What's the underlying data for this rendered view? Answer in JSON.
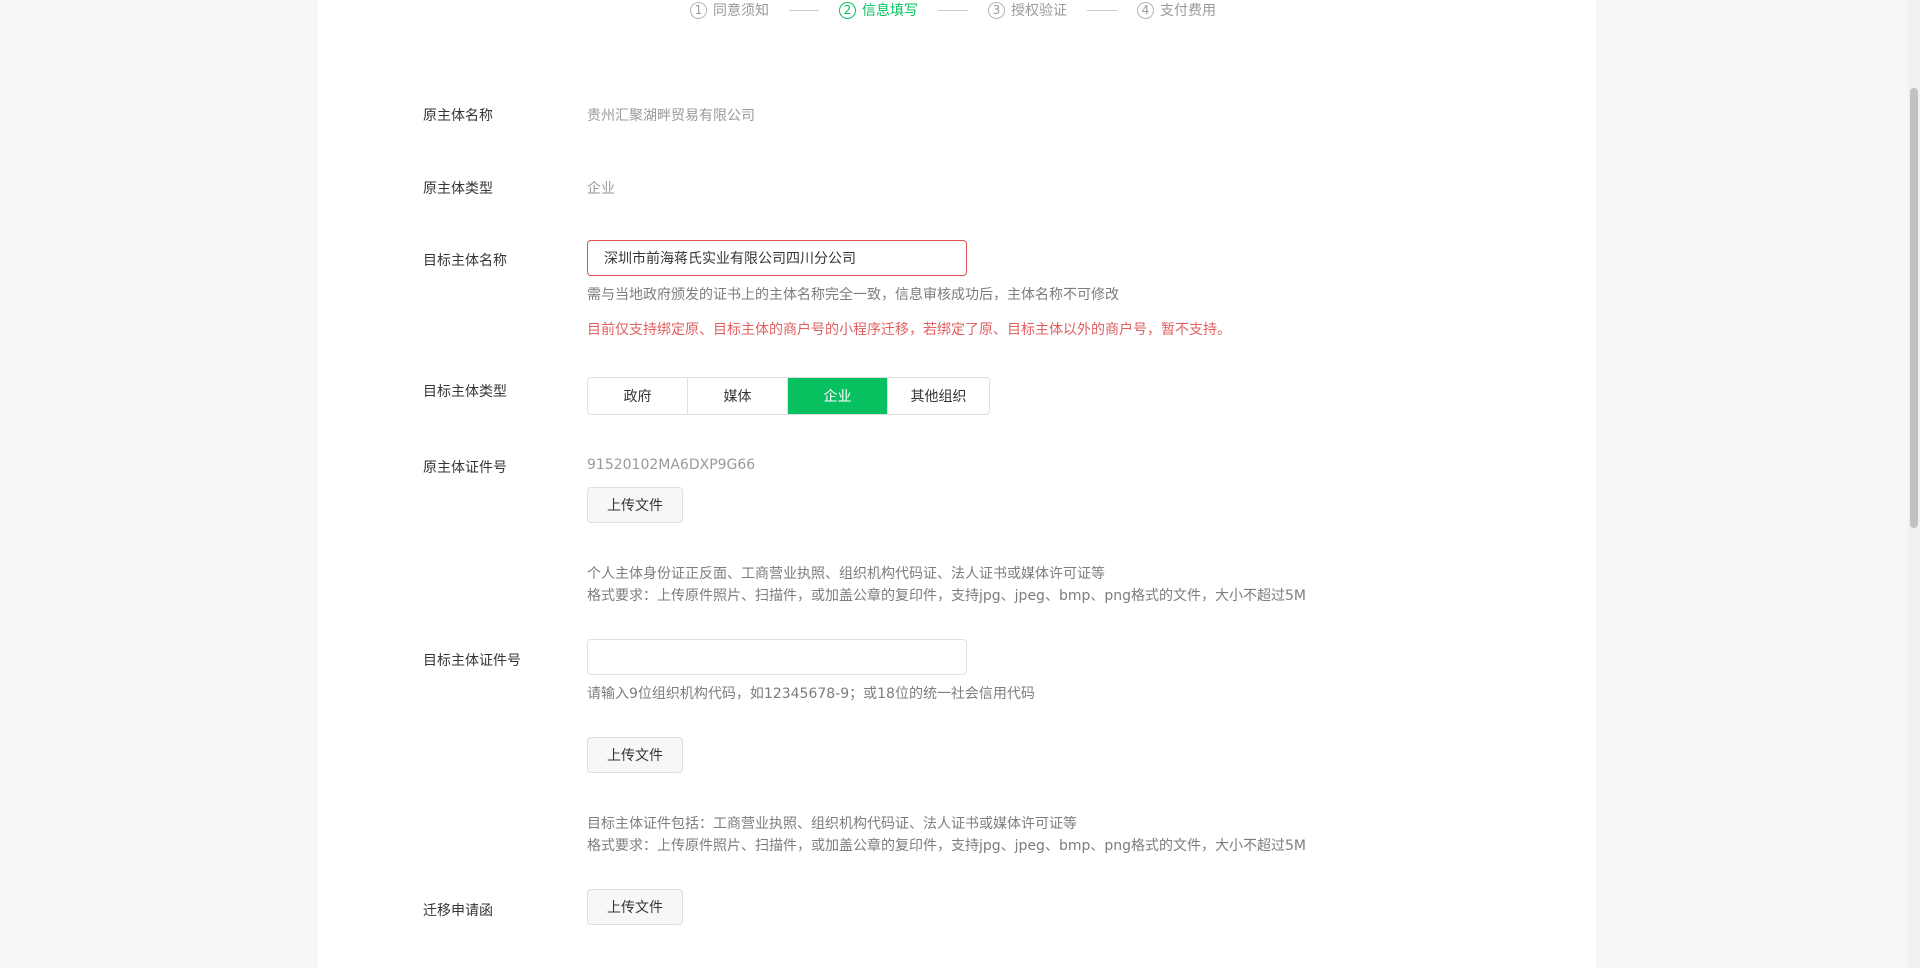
{
  "steps": [
    {
      "num": "1",
      "label": "同意须知"
    },
    {
      "num": "2",
      "label": "信息填写"
    },
    {
      "num": "3",
      "label": "授权验证"
    },
    {
      "num": "4",
      "label": "支付费用"
    }
  ],
  "form": {
    "orig_name_label": "原主体名称",
    "orig_name_value": "贵州汇聚湖畔贸易有限公司",
    "orig_type_label": "原主体类型",
    "orig_type_value": "企业",
    "target_name_label": "目标主体名称",
    "target_name_value": "深圳市前海蒋氏实业有限公司四川分公司",
    "target_name_tip": "需与当地政府颁发的证书上的主体名称完全一致，信息审核成功后，主体名称不可修改",
    "target_name_warning": "目前仅支持绑定原、目标主体的商户号的小程序迁移，若绑定了原、目标主体以外的商户号，暂不支持。",
    "target_type_label": "目标主体类型",
    "target_type_options": [
      "政府",
      "媒体",
      "企业",
      "其他组织"
    ],
    "target_type_selected": "企业",
    "orig_cert_label": "原主体证件号",
    "orig_cert_value": "91520102MA6DXP9G66",
    "upload_label": "上传文件",
    "orig_cert_tip1": "个人主体身份证正反面、工商营业执照、组织机构代码证、法人证书或媒体许可证等",
    "orig_cert_tip2": "格式要求：上传原件照片、扫描件，或加盖公章的复印件，支持jpg、jpeg、bmp、png格式的文件，大小不超过5M",
    "target_cert_label": "目标主体证件号",
    "target_cert_value": "",
    "target_cert_hint": "请输入9位组织机构代码，如12345678-9；或18位的统一社会信用代码",
    "target_cert_tip1": "目标主体证件包括：工商营业执照、组织机构代码证、法人证书或媒体许可证等",
    "target_cert_tip2": "格式要求：上传原件照片、扫描件，或加盖公章的复印件，支持jpg、jpeg、bmp、png格式的文件，大小不超过5M",
    "migration_label": "迁移申请函"
  },
  "colors": {
    "accent": "#07c160",
    "warning": "#e15f5f",
    "error_border": "#d9534f"
  }
}
